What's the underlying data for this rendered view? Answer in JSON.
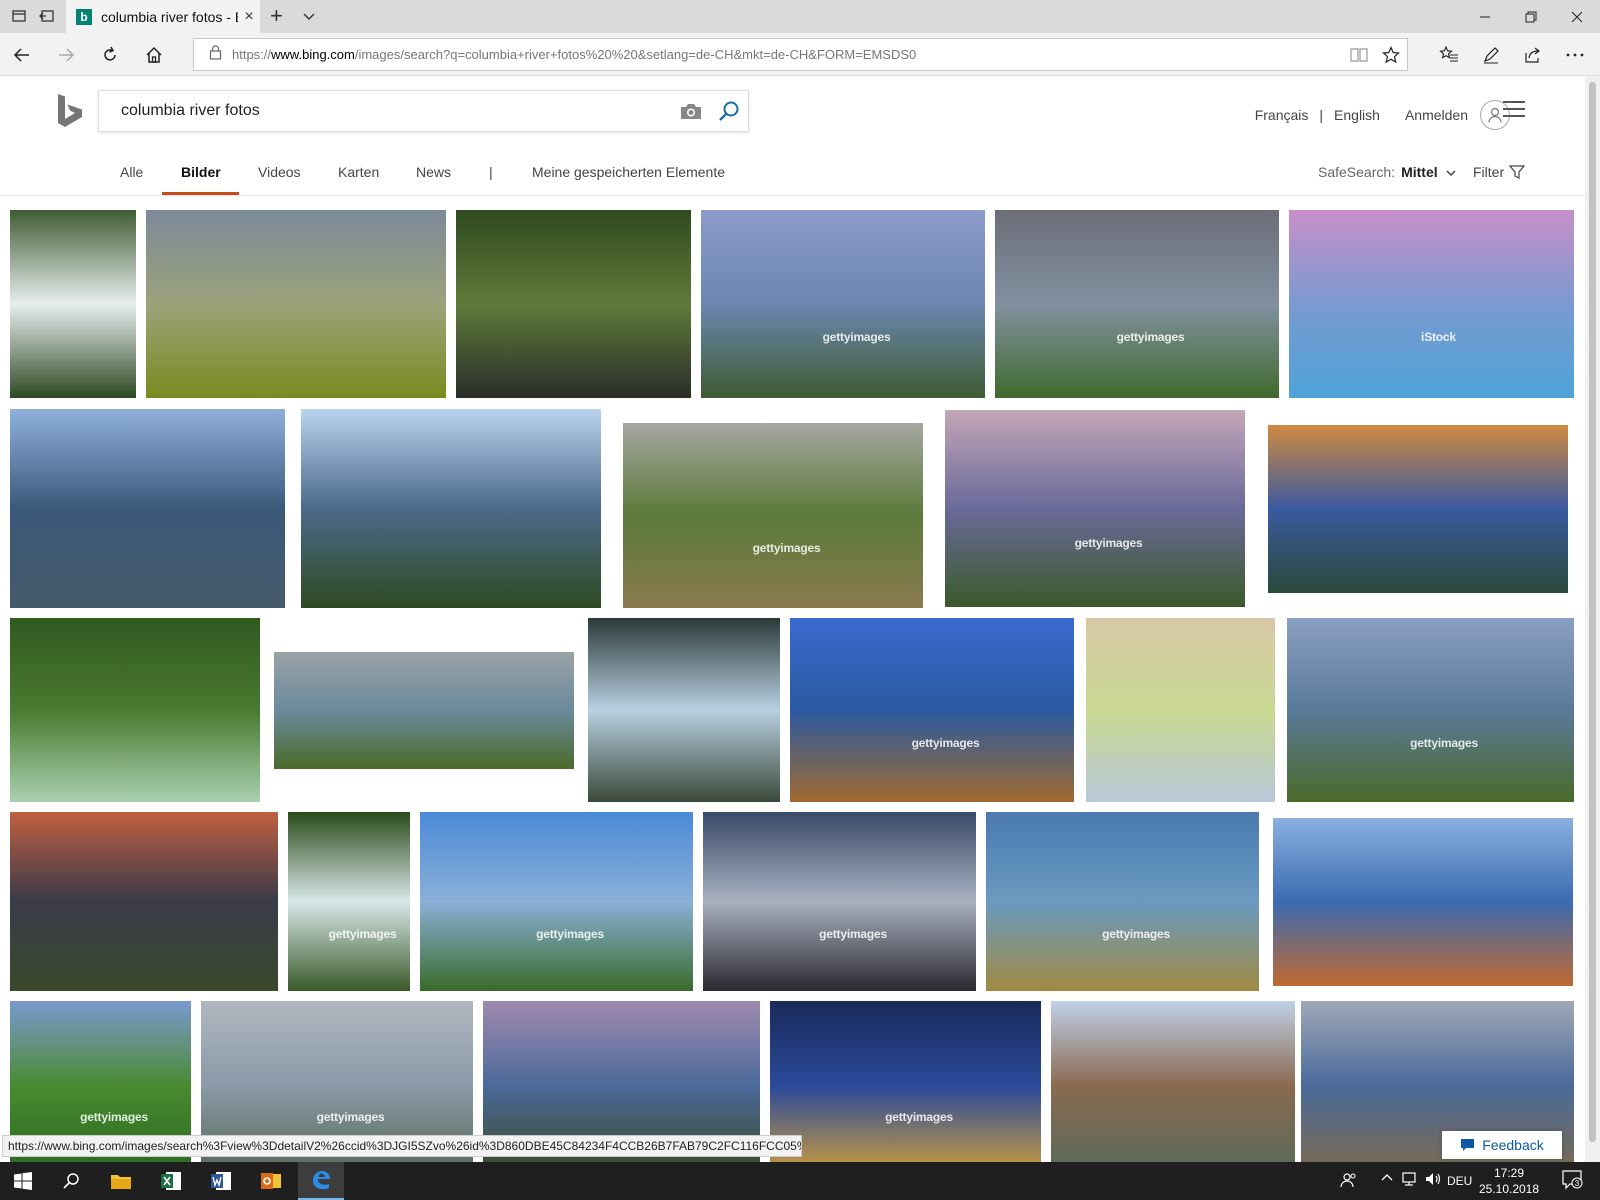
{
  "browser": {
    "tab_title": "columbia river fotos - B",
    "tab_favicon": "b",
    "new_tab_symbol": "+",
    "url_prefix": "https://",
    "url_domain": "www.bing.com",
    "url_rest": "/images/search?q=columbia+river+fotos%20%20&setlang=de-CH&mkt=de-CH&FORM=EMSDS0"
  },
  "search": {
    "query": "columbia river fotos"
  },
  "header": {
    "lang_fr": "Français",
    "lang_sep": "|",
    "lang_en": "English",
    "sign_in": "Anmelden"
  },
  "scopes": {
    "all": "Alle",
    "images": "Bilder",
    "videos": "Videos",
    "maps": "Karten",
    "news": "News",
    "sep": "|",
    "saved": "Meine gespeicherten Elemente",
    "safesearch_label": "SafeSearch:",
    "safesearch_value": "Mittel",
    "filter": "Filter"
  },
  "thumbnails": [
    {
      "alt": "waterfall",
      "colors": [
        "#3f5c32",
        "#e8eef0",
        "#2d4a22"
      ],
      "watermark": ""
    },
    {
      "alt": "river gorge autumn",
      "colors": [
        "#7d8a9a",
        "#9aa37a",
        "#7b8a1f"
      ],
      "watermark": ""
    },
    {
      "alt": "mossy canyon",
      "colors": [
        "#2f4a1f",
        "#5f7a3a",
        "#2a2e2a"
      ],
      "watermark": ""
    },
    {
      "alt": "columbia gorge view",
      "colors": [
        "#8d9bc9",
        "#6a87b0",
        "#3e5a30"
      ],
      "watermark": "gettyimages"
    },
    {
      "alt": "cloudy gorge",
      "colors": [
        "#6c6e78",
        "#8190a0",
        "#3f6a2c"
      ],
      "watermark": "gettyimages"
    },
    {
      "alt": "sunset river",
      "colors": [
        "#c88fc9",
        "#7a9ad0",
        "#4da3d8"
      ],
      "watermark": "iStock"
    },
    {
      "alt": "river water",
      "colors": [
        "#8fb0dc",
        "#3a5a7a",
        "#465a6a"
      ],
      "watermark": ""
    },
    {
      "alt": "gorge trees",
      "colors": [
        "#b9d4ee",
        "#4a6a8a",
        "#2f4a22"
      ],
      "watermark": ""
    },
    {
      "alt": "vineyard",
      "colors": [
        "#a7a7a0",
        "#5a7a3a",
        "#8a7a50"
      ],
      "watermark": "gettyimages"
    },
    {
      "alt": "bridge river",
      "colors": [
        "#c4a7b8",
        "#6a6a9a",
        "#3a5a2a"
      ],
      "watermark": "gettyimages"
    },
    {
      "alt": "sunset gorge",
      "colors": [
        "#d08a40",
        "#3a5aa0",
        "#2a4a3a"
      ],
      "watermark": ""
    },
    {
      "alt": "forest river",
      "colors": [
        "#2f5a20",
        "#4a7a30",
        "#a8d0b0"
      ],
      "watermark": ""
    },
    {
      "alt": "gorge panorama",
      "colors": [
        "#9aa3a8",
        "#6a8a9a",
        "#4a6a2a"
      ],
      "watermark": ""
    },
    {
      "alt": "waterfall bridge",
      "colors": [
        "#2a3a3a",
        "#b8d0e0",
        "#3a4a3a"
      ],
      "watermark": ""
    },
    {
      "alt": "blue river valley",
      "colors": [
        "#3a6ad0",
        "#2a5aa0",
        "#a06a30"
      ],
      "watermark": "gettyimages"
    },
    {
      "alt": "river map",
      "colors": [
        "#d8c8a8",
        "#c8d890",
        "#b8c8d8"
      ],
      "watermark": ""
    },
    {
      "alt": "gorge vista",
      "colors": [
        "#8aa0c0",
        "#5a7a9a",
        "#4a6a2a"
      ],
      "watermark": "gettyimages"
    },
    {
      "alt": "dusk gorge",
      "colors": [
        "#c06040",
        "#3a3a4a",
        "#3a4a2a"
      ],
      "watermark": ""
    },
    {
      "alt": "multnomah falls",
      "colors": [
        "#2a4a1a",
        "#d8e8e8",
        "#3a5a2a"
      ],
      "watermark": "gettyimages"
    },
    {
      "alt": "sunburst gorge",
      "colors": [
        "#4a8ad8",
        "#8ab0d8",
        "#3a6a2a"
      ],
      "watermark": "gettyimages"
    },
    {
      "alt": "evening lake",
      "colors": [
        "#3a4a6a",
        "#a8b0c0",
        "#2a2a30"
      ],
      "watermark": "gettyimages"
    },
    {
      "alt": "vista house",
      "colors": [
        "#4a7ab0",
        "#6a9ac0",
        "#a08a40"
      ],
      "watermark": "gettyimages"
    },
    {
      "alt": "red cliffs",
      "colors": [
        "#8ab0e0",
        "#3a6ab0",
        "#c06a30"
      ],
      "watermark": ""
    },
    {
      "alt": "green hills river",
      "colors": [
        "#7a9ad0",
        "#4a8a30",
        "#2a6a20"
      ],
      "watermark": "gettyimages"
    },
    {
      "alt": "misty river",
      "colors": [
        "#b0b8c0",
        "#8a9aa8",
        "#5a6a5a"
      ],
      "watermark": "gettyimages"
    },
    {
      "alt": "purple sky gorge",
      "colors": [
        "#a08ab0",
        "#4a6a9a",
        "#3a4a2a"
      ],
      "watermark": ""
    },
    {
      "alt": "bridge night",
      "colors": [
        "#1a2a5a",
        "#2a4a9a",
        "#c89a40"
      ],
      "watermark": "gettyimages"
    },
    {
      "alt": "riverside restaurant",
      "colors": [
        "#c0d0e8",
        "#8a6a50",
        "#5a6a5a"
      ],
      "watermark": ""
    },
    {
      "alt": "rocky canyon",
      "colors": [
        "#a0a8b8",
        "#4a6a9a",
        "#7a6a50"
      ],
      "watermark": ""
    }
  ],
  "status_url": "https://www.bing.com/images/search%3Fview%3DdetailV2%26ccid%3DJGI5SZvo%26id%3D860DBE45C84234F4CCB26B7FAB79C2FC116FCC05%26thic",
  "feedback": "Feedback",
  "taskbar": {
    "language": "DEU",
    "time": "17:29",
    "date": "25.10.2018",
    "notifications": "3"
  }
}
